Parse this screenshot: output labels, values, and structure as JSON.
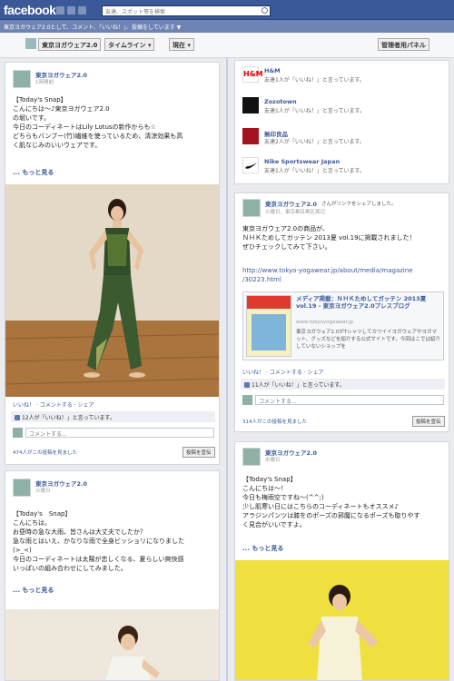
{
  "topbar": {
    "logo": "facebook",
    "search_placeholder": "友達、スポット等を検索"
  },
  "subbar": {
    "text": "東京ヨガウェア2.0として、コメント、「いいね！」、投稿をしています ▼"
  },
  "page_header": {
    "page_name": "東京ヨガウェア2.0",
    "timeline_label": "タイムライン ▾",
    "current_label": "現在 ▾",
    "admin_panel": "管理者用パネル"
  },
  "post1": {
    "author": "東京ヨガウェア2.0",
    "date": "1時間前",
    "body": "【Today's Snap】\nこんにちは～♪東京ヨガウェア2.0\nの堀いです。\n今日のコーディネートはLily Lotusの新作からも☆\nどちらもバンブー(竹)繊維を使っているため、清涼効果も高\nく肌なじみのいいウェアです。",
    "more": "... もっと見る",
    "actions": "いいね！ · コメントする · シェア",
    "likes": "12人が「いいね！」と言っています。",
    "comment_placeholder": "コメントする...",
    "footer_left": "474人がこの投稿を見ました",
    "footer_button": "投稿を宣伝"
  },
  "likes_card": {
    "items": [
      {
        "name": "H&M",
        "sub": "友達1人が「いいね！」と言っています。"
      },
      {
        "name": "Zozotown",
        "sub": "友達1人が「いいね！」と言っています。"
      },
      {
        "name": "無印良品",
        "sub": "友達2人が「いいね！」と言っています。"
      },
      {
        "name": "Nike Sportswear Japan",
        "sub": "友達1人が「いいね！」と言っています。"
      }
    ]
  },
  "post2": {
    "author": "東京ヨガウェア2.0",
    "shared": "さんがリンクをシェアしました。",
    "date": "火曜日、東京都目黒区周辺",
    "body": "東京ヨガウェア2.0の商品が、\nＮＨＫためしてガッテン 2013夏 vol.19に掲載されました！\nぜひチェックしてみて下さい。",
    "url": "http://www.tokyo-yogawear.jp/about/media/magazine\n/30223.html",
    "article_title": "メディア掲載：ＮＨＫためしてガッテン 2013夏 vol.19 - 東京ヨガウェア2.0プレスブログ",
    "article_domain": "www.tokyoyogawear.jp",
    "article_desc": "東京ヨガウェア2.0がTシャツしてカワイイヨガウェアやヨガマット、グッズなどを紹介する公式サイトです。今回はこでは紹介していないショップを",
    "actions": "いいね！ · コメントする · シェア",
    "likes": "11人が「いいね！」と言っています。",
    "comment_placeholder": "コメントする...",
    "footer_left": "314人がこの投稿を見ました",
    "footer_button": "投稿を宣伝"
  },
  "post3": {
    "author": "東京ヨガウェア2.0",
    "date": "火曜日",
    "body": "【Today's　Snap】\nこんにちは。\nお昼時の急な大雨、皆さんは大丈夫でしたか？\n急な雨とはいえ、かなりな雨で全身ビッショリになりました\n(>_<)\n今日のコーディネートは太陽が恋しくなる、夏らしい爽快感\nいっぱいの組み合わせにしてみました。",
    "more": "... もっと見る"
  },
  "post4": {
    "author": "東京ヨガウェア2.0",
    "date": "水曜日",
    "body": "【Today's Snap】\nこんにちは～！\n今日も梅雨空ですね～(^^;)\n少し肌寒い日にはこちらのコーディネートもオススメ♪\nアラジンパンツは膝をのポーズの邪魔になるポーズも取りやす\nく見合がいいですよ。",
    "more": "... もっと見る"
  }
}
